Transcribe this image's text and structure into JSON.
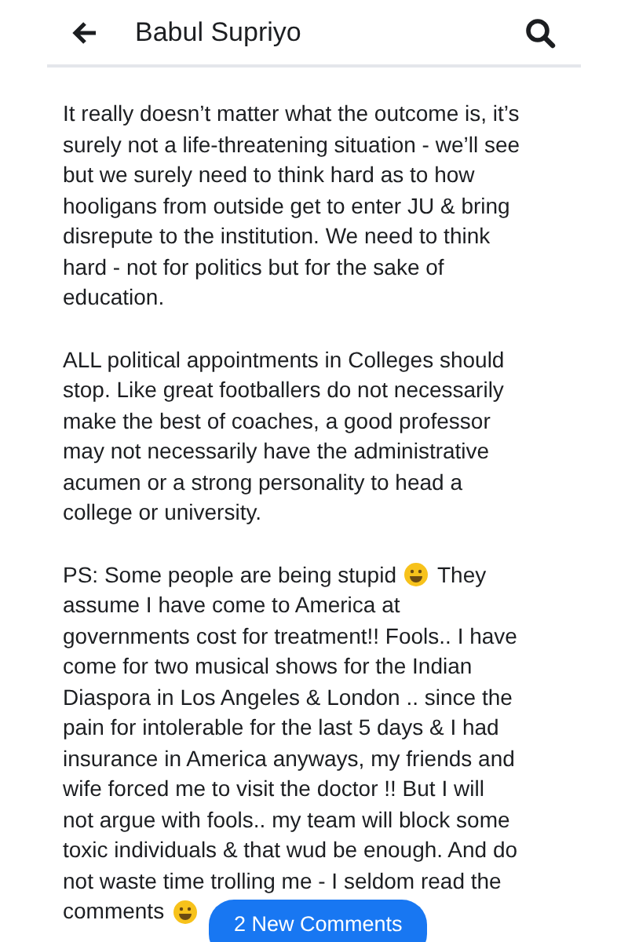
{
  "header": {
    "title": "Babul Supriyo"
  },
  "post": {
    "paragraphs": [
      {
        "lines": [
          [
            {
              "kind": "text",
              "text": "It really doesn’t matter what the outcome is, it’s"
            }
          ],
          [
            {
              "kind": "text",
              "text": "surely not a life-threatening situation - we’ll see"
            }
          ],
          [
            {
              "kind": "text",
              "text": "but we surely need to think hard as to how"
            }
          ],
          [
            {
              "kind": "text",
              "text": "hooligans from outside get to enter JU & bring"
            }
          ],
          [
            {
              "kind": "text",
              "text": "disrepute to the institution. We need to think"
            }
          ],
          [
            {
              "kind": "text",
              "text": "hard - not for politics but for the sake of"
            }
          ],
          [
            {
              "kind": "text",
              "text": "education."
            }
          ]
        ]
      },
      {
        "lines": [
          [
            {
              "kind": "text",
              "text": "ALL political appointments in Colleges should"
            }
          ],
          [
            {
              "kind": "text",
              "text": "stop. Like great footballers do not necessarily"
            }
          ],
          [
            {
              "kind": "text",
              "text": "make the best of coaches, a good professor"
            }
          ],
          [
            {
              "kind": "text",
              "text": "may not necessarily have the administrative"
            }
          ],
          [
            {
              "kind": "text",
              "text": "acumen or a strong personality to head a"
            }
          ],
          [
            {
              "kind": "text",
              "text": "college or university."
            }
          ]
        ]
      },
      {
        "lines": [
          [
            {
              "kind": "text",
              "text": "PS: Some people are being stupid"
            },
            {
              "kind": "emoji"
            },
            {
              "kind": "text",
              "text": "They"
            }
          ],
          [
            {
              "kind": "text",
              "text": "assume I have come to America at"
            }
          ],
          [
            {
              "kind": "text",
              "text": "governments cost for treatment!! Fools.. I have"
            }
          ],
          [
            {
              "kind": "text",
              "text": "come for two musical shows for the Indian"
            }
          ],
          [
            {
              "kind": "text",
              "text": "Diaspora in Los Angeles & London .. since the"
            }
          ],
          [
            {
              "kind": "text",
              "text": "pain for intolerable for the last 5 days & I had"
            }
          ],
          [
            {
              "kind": "text",
              "text": "insurance in America anyways, my friends and"
            }
          ],
          [
            {
              "kind": "text",
              "text": "wife forced me to visit the doctor !! But I will"
            }
          ],
          [
            {
              "kind": "text",
              "text": "not argue with fools.. my team will block some"
            }
          ],
          [
            {
              "kind": "text",
              "text": "toxic individuals & that wud be enough. And do"
            }
          ],
          [
            {
              "kind": "text",
              "text": "not waste time trolling me - I seldom read the"
            }
          ],
          [
            {
              "kind": "text",
              "text": "comments"
            },
            {
              "kind": "emoji"
            }
          ]
        ]
      }
    ]
  },
  "new_comments_button": {
    "label": "2 New Comments"
  }
}
